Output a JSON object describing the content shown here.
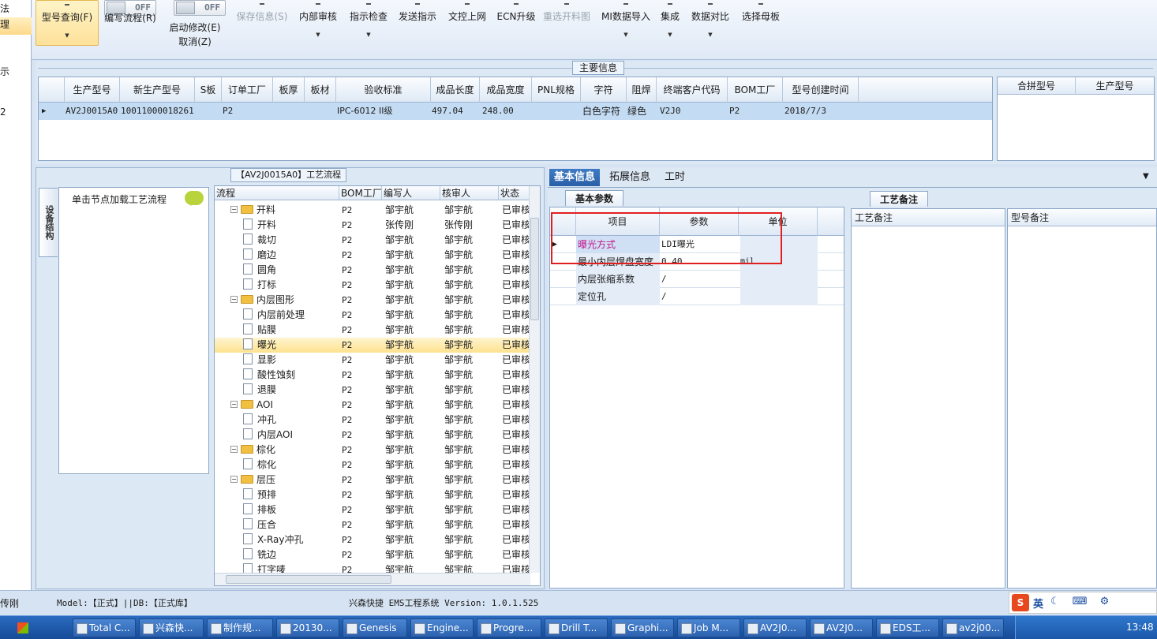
{
  "left_strip": {
    "items": [
      "法",
      "理",
      "示",
      "2"
    ],
    "status_fragment": "传刚"
  },
  "ribbon": {
    "query": "型号查询(F)",
    "write_flow": "编写流程(R)",
    "toggle_off": "OFF",
    "start_modify": "启动修改(E)",
    "cancel": "取消(Z)",
    "save_info": "保存信息(S)",
    "internal_review": "内部审核",
    "indicator_check": "指示检查",
    "send_indicator": "发送指示",
    "file_control_upload": "文控上网",
    "ecn_upgrade": "ECN升级",
    "reselect_chart": "重选开料图",
    "mi_import": "MI数据导入",
    "integrate": "集成",
    "data_compare": "数据对比",
    "select_mother": "选择母板"
  },
  "main_info": {
    "title": "主要信息",
    "columns": [
      "生产型号",
      "新生产型号",
      "S板",
      "订单工厂",
      "板厚",
      "板材",
      "验收标准",
      "成品长度",
      "成品宽度",
      "PNL规格",
      "字符",
      "阻焊",
      "终端客户代码",
      "BOM工厂",
      "型号创建时间"
    ],
    "row": {
      "prod_model": "AV2J0015A0",
      "new_prod_model": "10011000018261",
      "order_factory": "P2",
      "standard": "IPC-6012 II级",
      "length": "497.04",
      "width": "248.00",
      "char": "白色字符",
      "solder": "绿色",
      "customer": "V2J0",
      "bom_factory": "P2",
      "created": "2018/7/3"
    },
    "side_columns": [
      "合拼型号",
      "生产型号"
    ]
  },
  "process": {
    "title": "【AV2J0015A0】工艺流程",
    "vertical_tab": "设备结构",
    "hint": "单击节点加载工艺流程",
    "columns": [
      "流程",
      "BOM工厂",
      "编写人",
      "核审人",
      "状态"
    ],
    "rows": [
      {
        "name": "开料",
        "folder": true,
        "factory": "P2",
        "writer": "邹宇航",
        "reviewer": "邹宇航",
        "status": "已审核"
      },
      {
        "name": "开料",
        "folder": false,
        "factory": "P2",
        "writer": "张传刚",
        "reviewer": "张传刚",
        "status": "已审核"
      },
      {
        "name": "裁切",
        "folder": false,
        "factory": "P2",
        "writer": "邹宇航",
        "reviewer": "邹宇航",
        "status": "已审核"
      },
      {
        "name": "磨边",
        "folder": false,
        "factory": "P2",
        "writer": "邹宇航",
        "reviewer": "邹宇航",
        "status": "已审核"
      },
      {
        "name": "圆角",
        "folder": false,
        "factory": "P2",
        "writer": "邹宇航",
        "reviewer": "邹宇航",
        "status": "已审核"
      },
      {
        "name": "打标",
        "folder": false,
        "factory": "P2",
        "writer": "邹宇航",
        "reviewer": "邹宇航",
        "status": "已审核"
      },
      {
        "name": "内层图形",
        "folder": true,
        "factory": "P2",
        "writer": "邹宇航",
        "reviewer": "邹宇航",
        "status": "已审核"
      },
      {
        "name": "内层前处理",
        "folder": false,
        "factory": "P2",
        "writer": "邹宇航",
        "reviewer": "邹宇航",
        "status": "已审核"
      },
      {
        "name": "贴膜",
        "folder": false,
        "factory": "P2",
        "writer": "邹宇航",
        "reviewer": "邹宇航",
        "status": "已审核"
      },
      {
        "name": "曝光",
        "folder": false,
        "factory": "P2",
        "writer": "邹宇航",
        "reviewer": "邹宇航",
        "status": "已审核",
        "selected": true
      },
      {
        "name": "显影",
        "folder": false,
        "factory": "P2",
        "writer": "邹宇航",
        "reviewer": "邹宇航",
        "status": "已审核"
      },
      {
        "name": "酸性蚀刻",
        "folder": false,
        "factory": "P2",
        "writer": "邹宇航",
        "reviewer": "邹宇航",
        "status": "已审核"
      },
      {
        "name": "退膜",
        "folder": false,
        "factory": "P2",
        "writer": "邹宇航",
        "reviewer": "邹宇航",
        "status": "已审核"
      },
      {
        "name": "AOI",
        "folder": true,
        "factory": "P2",
        "writer": "邹宇航",
        "reviewer": "邹宇航",
        "status": "已审核"
      },
      {
        "name": "冲孔",
        "folder": false,
        "factory": "P2",
        "writer": "邹宇航",
        "reviewer": "邹宇航",
        "status": "已审核"
      },
      {
        "name": "内层AOI",
        "folder": false,
        "factory": "P2",
        "writer": "邹宇航",
        "reviewer": "邹宇航",
        "status": "已审核"
      },
      {
        "name": "棕化",
        "folder": true,
        "factory": "P2",
        "writer": "邹宇航",
        "reviewer": "邹宇航",
        "status": "已审核"
      },
      {
        "name": "棕化",
        "folder": false,
        "factory": "P2",
        "writer": "邹宇航",
        "reviewer": "邹宇航",
        "status": "已审核"
      },
      {
        "name": "层压",
        "folder": true,
        "factory": "P2",
        "writer": "邹宇航",
        "reviewer": "邹宇航",
        "status": "已审核"
      },
      {
        "name": "预排",
        "folder": false,
        "factory": "P2",
        "writer": "邹宇航",
        "reviewer": "邹宇航",
        "status": "已审核"
      },
      {
        "name": "排板",
        "folder": false,
        "factory": "P2",
        "writer": "邹宇航",
        "reviewer": "邹宇航",
        "status": "已审核"
      },
      {
        "name": "压合",
        "folder": false,
        "factory": "P2",
        "writer": "邹宇航",
        "reviewer": "邹宇航",
        "status": "已审核"
      },
      {
        "name": "X-Ray冲孔",
        "folder": false,
        "factory": "P2",
        "writer": "邹宇航",
        "reviewer": "邹宇航",
        "status": "已审核"
      },
      {
        "name": "铣边",
        "folder": false,
        "factory": "P2",
        "writer": "邹宇航",
        "reviewer": "邹宇航",
        "status": "已审核"
      },
      {
        "name": "打字唛",
        "folder": false,
        "factory": "P2",
        "writer": "邹宇航",
        "reviewer": "邹宇航",
        "status": "已审核"
      }
    ]
  },
  "info": {
    "tabs": [
      "基本信息",
      "拓展信息",
      "工时"
    ],
    "params_tab": "基本参数",
    "notes_tab": "工艺备注",
    "param_columns": [
      "项目",
      "参数",
      "单位"
    ],
    "params": [
      {
        "item": "曝光方式",
        "value": "LDI曝光",
        "unit": ""
      },
      {
        "item": "最小内层焊盘宽度",
        "value": "0.40",
        "unit": "mil"
      },
      {
        "item": "内层张缩系数",
        "value": "/",
        "unit": ""
      },
      {
        "item": "定位孔",
        "value": "/",
        "unit": ""
      }
    ],
    "notes_col1": "工艺备注",
    "notes_col2": "型号备注"
  },
  "status_bar": {
    "model": "Model:【正式】||DB:【正式库】",
    "system": "兴森快捷 EMS工程系统 Version: 1.0.1.525"
  },
  "ime": {
    "lang": "英"
  },
  "taskbar": {
    "items": [
      "Total C...",
      "兴森快...",
      "制作规...",
      "20130...",
      "Genesis",
      "Engine...",
      "Progre...",
      "Drill T...",
      "Graphi...",
      "Job M...",
      "AV2J0...",
      "AV2J0...",
      "EDS工...",
      "av2j00..."
    ],
    "time": "13:48"
  },
  "colors": {
    "accent": "#2a5fa6",
    "highlight_row": "#fde28e",
    "alert_red": "#e02020",
    "pink_text": "#c2188b"
  }
}
